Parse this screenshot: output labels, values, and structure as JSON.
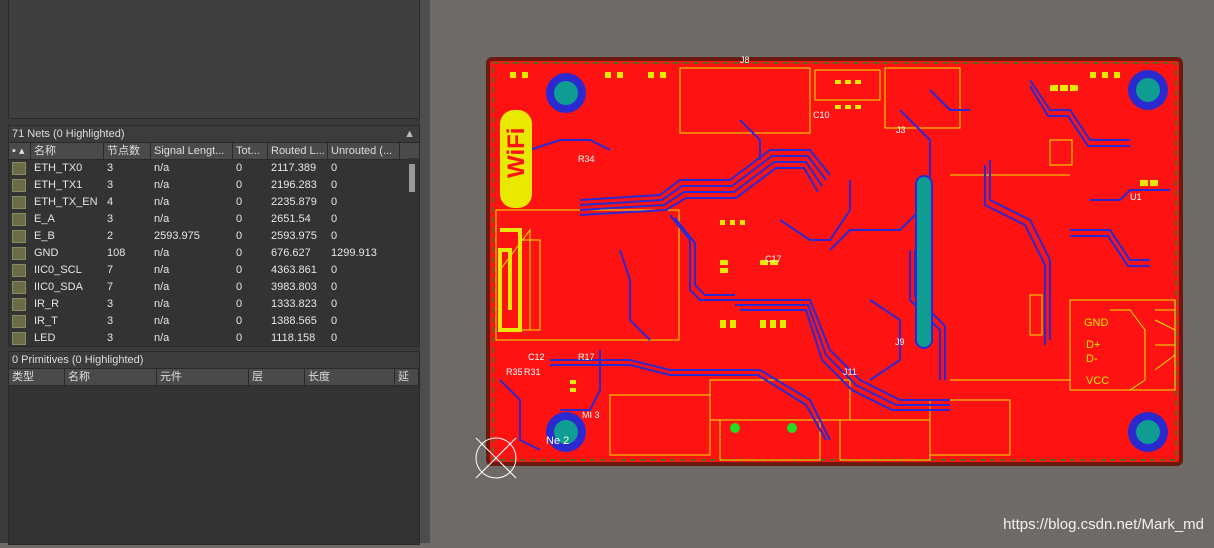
{
  "nets_panel": {
    "title": "71 Nets (0 Highlighted)",
    "columns": [
      "名称",
      "节点数",
      "Signal Lengt...",
      "Tot...",
      "Routed L...",
      "Unrouted (..."
    ],
    "rows": [
      {
        "name": "ETH_TX0",
        "nodes": "3",
        "signal": "n/a",
        "tot": "0",
        "routed": "2117.389",
        "unrouted": "0"
      },
      {
        "name": "ETH_TX1",
        "nodes": "3",
        "signal": "n/a",
        "tot": "0",
        "routed": "2196.283",
        "unrouted": "0"
      },
      {
        "name": "ETH_TX_EN",
        "nodes": "4",
        "signal": "n/a",
        "tot": "0",
        "routed": "2235.879",
        "unrouted": "0"
      },
      {
        "name": "E_A",
        "nodes": "3",
        "signal": "n/a",
        "tot": "0",
        "routed": "2651.54",
        "unrouted": "0"
      },
      {
        "name": "E_B",
        "nodes": "2",
        "signal": "2593.975",
        "tot": "0",
        "routed": "2593.975",
        "unrouted": "0"
      },
      {
        "name": "GND",
        "nodes": "108",
        "signal": "n/a",
        "tot": "0",
        "routed": "676.627",
        "unrouted": "1299.913"
      },
      {
        "name": "IIC0_SCL",
        "nodes": "7",
        "signal": "n/a",
        "tot": "0",
        "routed": "4363.861",
        "unrouted": "0"
      },
      {
        "name": "IIC0_SDA",
        "nodes": "7",
        "signal": "n/a",
        "tot": "0",
        "routed": "3983.803",
        "unrouted": "0"
      },
      {
        "name": "IR_R",
        "nodes": "3",
        "signal": "n/a",
        "tot": "0",
        "routed": "1333.823",
        "unrouted": "0"
      },
      {
        "name": "IR_T",
        "nodes": "3",
        "signal": "n/a",
        "tot": "0",
        "routed": "1388.565",
        "unrouted": "0"
      },
      {
        "name": "LED",
        "nodes": "3",
        "signal": "n/a",
        "tot": "0",
        "routed": "1118.158",
        "unrouted": "0"
      }
    ]
  },
  "primitives_panel": {
    "title": "0 Primitives (0 Highlighted)",
    "columns": [
      "类型",
      "名称",
      "元件",
      "层",
      "长度",
      "延"
    ]
  },
  "board": {
    "wifi_text": "WiFi",
    "labels": {
      "gnd": "GND",
      "dplus": "D+",
      "dminus": "D-",
      "vcc": "VCC",
      "j3": "J3",
      "j8": "J8",
      "j9": "J9",
      "j11": "J11",
      "u1": "U1",
      "c10": "C10",
      "c12": "C12",
      "r17": "R17",
      "r35": "R35",
      "r31": "R31",
      "r34": "R34",
      "c17": "C17",
      "m13": "MI 3",
      "no2": "Ne   2"
    }
  },
  "watermark": "https://blog.csdn.net/Mark_md",
  "colors": {
    "board_red": "#ff1212",
    "trace_blue": "#2a2ad0",
    "silk_yellow": "#e8e800",
    "pad_teal": "#0e9c93",
    "edge": "#6b1a10"
  }
}
